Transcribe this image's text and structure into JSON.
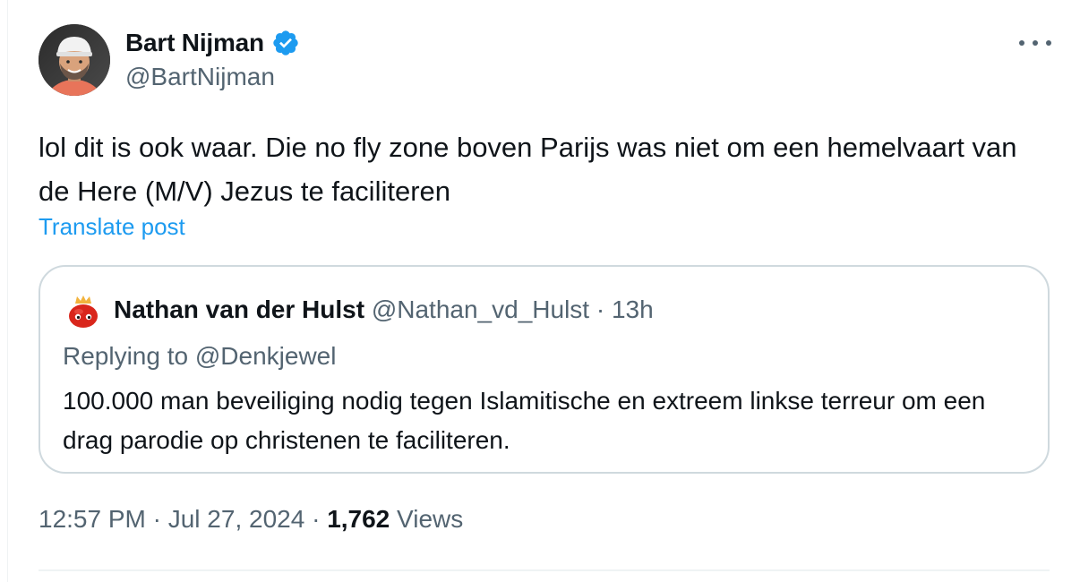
{
  "post": {
    "author": {
      "name": "Bart Nijman",
      "handle": "@BartNijman",
      "verified": true
    },
    "text": "lol dit is ook waar. Die no fly zone boven Parijs was niet om een hemelvaart van de Here (M/V) Jezus te faciliteren",
    "translate_label": "Translate post",
    "timestamp": "12:57 PM · Jul 27, 2024",
    "separator": "·",
    "views_count": "1,762",
    "views_label": "Views"
  },
  "quote": {
    "name": "Nathan van der Hulst",
    "handle": "@Nathan_vd_Hulst",
    "meta_separator": "·",
    "age": "13h",
    "replying_to": "Replying to @Denkjewel",
    "text": "100.000 man beveiliging nodig tegen Islamitische  en extreem linkse terreur om een drag parodie op christenen te faciliteren."
  },
  "colors": {
    "text_primary": "#0f1419",
    "text_secondary": "#536471",
    "accent": "#1d9bf0",
    "border": "#cfd9de"
  },
  "icons": {
    "verified": "verified-badge-icon",
    "more": "more-dots-icon"
  }
}
